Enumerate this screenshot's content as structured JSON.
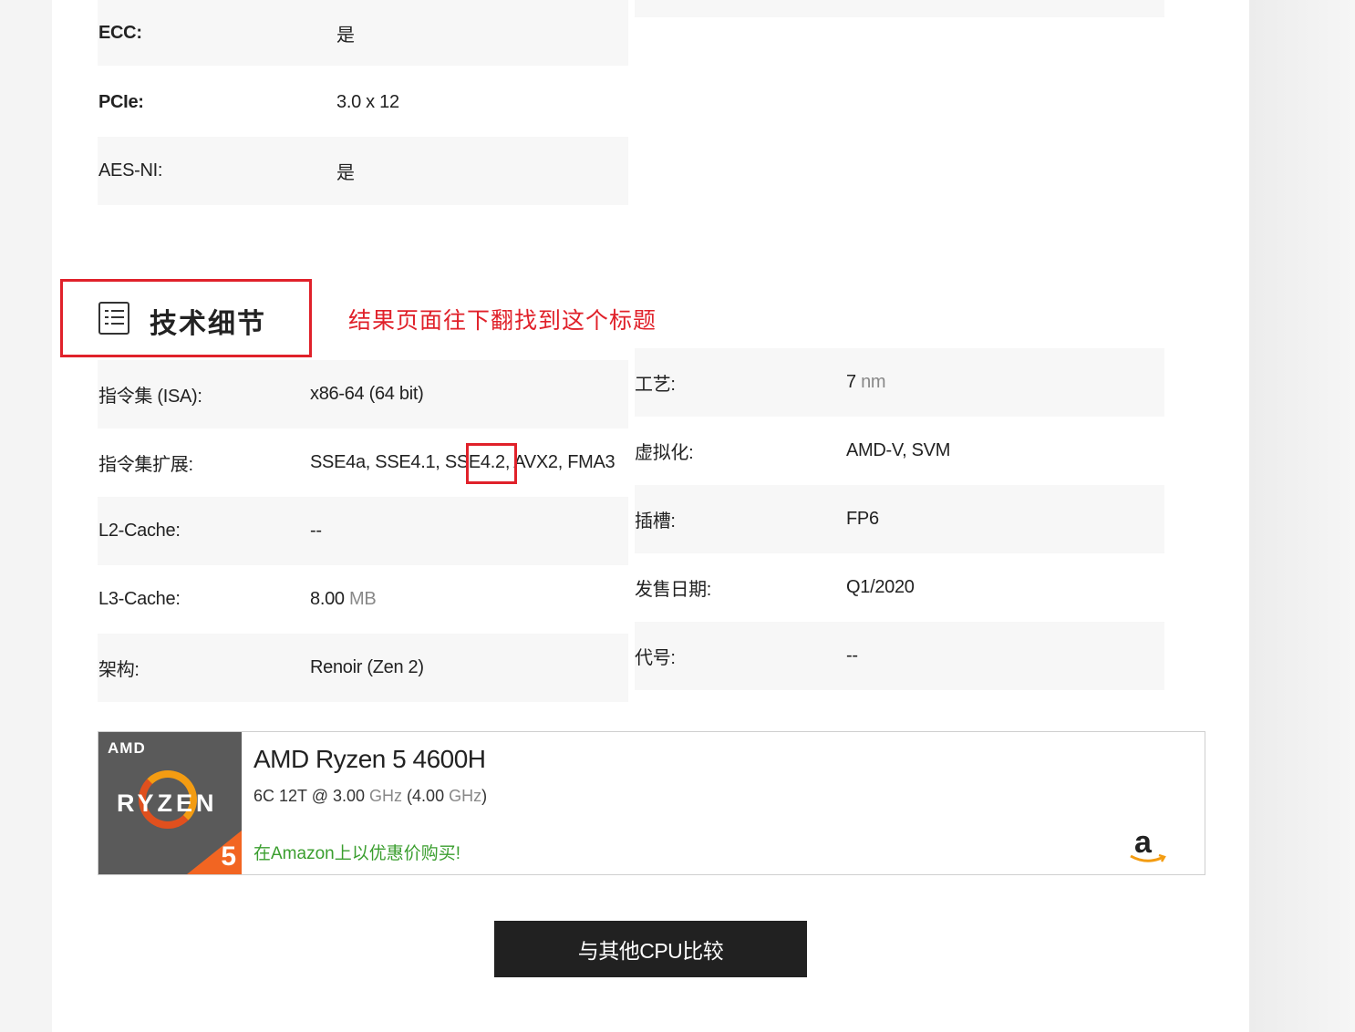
{
  "top_rows": [
    {
      "label": "ECC:",
      "value": "是"
    },
    {
      "label": "PCIe:",
      "value": "3.0 x 12"
    },
    {
      "label": "AES-NI:",
      "value": "是"
    }
  ],
  "section": {
    "icon": "list-icon",
    "title": "技术细节",
    "annotation": "结果页面往下翻找到这个标题"
  },
  "left_rows": [
    {
      "label": "指令集 (ISA):",
      "value": "x86-64 (64 bit)"
    },
    {
      "label": "指令集扩展:",
      "value_pre": "SSE4a, SSE4.1, SSE4.2, ",
      "value_highlight": "AVX2",
      "value_post": ", FMA3"
    },
    {
      "label": "L2-Cache:",
      "value": "--"
    },
    {
      "label": "L3-Cache:",
      "value_num": "8.00",
      "value_unit": "MB"
    },
    {
      "label": "架构:",
      "value": "Renoir (Zen 2)"
    }
  ],
  "right_rows": [
    {
      "label": "工艺:",
      "value_num": "7",
      "value_unit": "nm"
    },
    {
      "label": "虚拟化:",
      "value": "AMD-V, SVM"
    },
    {
      "label": "插槽:",
      "value": "FP6"
    },
    {
      "label": "发售日期:",
      "value": "Q1/2020"
    },
    {
      "label": "代号:",
      "value": "--"
    }
  ],
  "product_card": {
    "logo_brand": "AMD",
    "logo_series": "RYZEN",
    "logo_tier": "5",
    "title": "AMD Ryzen 5 4600H",
    "spec_cores": "6C 12T @ ",
    "spec_base": "3.00",
    "spec_base_unit": "GHz",
    "spec_boost_open": " (",
    "spec_boost": "4.00",
    "spec_boost_unit": "GHz",
    "spec_close": ")",
    "buy_text": "在Amazon上以优惠价购买!",
    "store_icon": "amazon-icon"
  },
  "compare_button": "与其他CPU比较",
  "colors": {
    "highlight_red": "#e0212a",
    "buy_green": "#3a9e2e",
    "button_dark": "#212121"
  }
}
